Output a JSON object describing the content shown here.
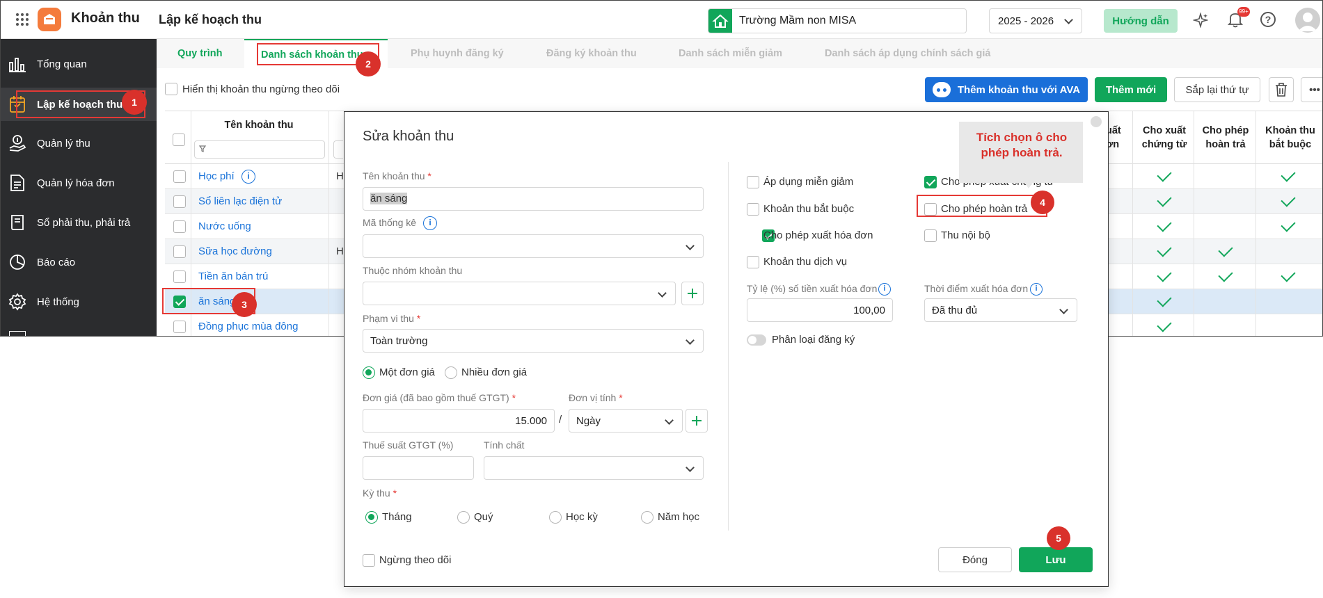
{
  "app": {
    "name": "Khoản thu",
    "page_title": "Lập kế hoạch thu",
    "school": "Trường Mầm non MISA",
    "year": "2025 - 2026",
    "guide_label": "Hướng dẫn",
    "notif_count": "99+"
  },
  "sidebar": {
    "items": [
      {
        "label": "Tổng quan"
      },
      {
        "label": "Lập kế hoạch thu"
      },
      {
        "label": "Quản lý thu"
      },
      {
        "label": "Quản lý hóa đơn"
      },
      {
        "label": "Sổ phải thu, phải trả"
      },
      {
        "label": "Báo cáo"
      },
      {
        "label": "Hệ thống"
      }
    ]
  },
  "tabs": [
    "Quy trình",
    "Danh sách khoản thu",
    "Phụ huynh đăng ký",
    "Đăng ký khoản thu",
    "Danh sách miễn giảm",
    "Danh sách áp dụng chính sách giá"
  ],
  "toolbar": {
    "show_inactive": "Hiển thị khoản thu ngừng theo dõi",
    "add_ava": "Thêm khoản thu với AVA",
    "add_new": "Thêm mới",
    "reorder": "Sắp lại thứ tự",
    "more": "•••"
  },
  "grid": {
    "col_name": "Tên khoản thu",
    "col_partial": "uất\nơn",
    "cols": [
      "Cho xuất chứng từ",
      "Cho phép hoàn trả",
      "Khoản thu bắt buộc"
    ],
    "rows": [
      {
        "name": "Học phí",
        "prefix": "H",
        "flags": [
          true,
          false,
          true
        ]
      },
      {
        "name": "Sổ liên lạc điện tử",
        "prefix": "",
        "flags": [
          true,
          false,
          true
        ]
      },
      {
        "name": "Nước uống",
        "prefix": "",
        "flags": [
          true,
          false,
          true
        ]
      },
      {
        "name": "Sữa học đường",
        "prefix": "H",
        "flags": [
          true,
          true,
          false
        ]
      },
      {
        "name": "Tiền ăn bán trú",
        "prefix": "",
        "flags": [
          true,
          true,
          true
        ]
      },
      {
        "name": "ăn sáng",
        "prefix": "",
        "flags": [
          true,
          false,
          false
        ]
      },
      {
        "name": "Đồng phục mùa đông",
        "prefix": "",
        "flags": [
          true,
          false,
          false
        ]
      }
    ]
  },
  "dialog": {
    "title": "Sửa khoản thu",
    "name_label": "Tên khoản thu",
    "name_value": "ăn sáng",
    "stat_label": "Mã thống kê",
    "group_label": "Thuộc nhóm khoản thu",
    "scope_label": "Phạm vi thu",
    "scope_value": "Toàn trường",
    "price_one": "Một đơn giá",
    "price_many": "Nhiều đơn giá",
    "price_label": "Đơn giá (đã bao gồm thuế GTGT)",
    "price_value": "15.000",
    "slash": "/",
    "unit_label": "Đơn vị tính",
    "unit_value": "Ngày",
    "vat_label": "Thuế suất GTGT (%)",
    "nature_label": "Tính chất",
    "period_label": "Kỳ thu",
    "periods": [
      "Tháng",
      "Quý",
      "Học kỳ",
      "Năm học"
    ],
    "stop_label": "Ngừng theo dõi",
    "checks": {
      "apply_discount": "Áp dụng miễn giảm",
      "allow_voucher": "Cho phép xuất chứng từ",
      "mandatory": "Khoản thu bắt buộc",
      "allow_refund": "Cho phép hoàn trả",
      "allow_invoice": "Cho phép xuất hóa đơn",
      "internal": "Thu nội bộ",
      "service": "Khoản thu dịch vụ"
    },
    "rate_label": "Tỷ lệ (%) số tiền xuất hóa đơn",
    "rate_value": "100,00",
    "time_label": "Thời điểm xuất hóa đơn",
    "time_value": "Đã thu đủ",
    "classify_label": "Phân loại đăng ký",
    "close_btn": "Đóng",
    "save_btn": "Lưu"
  },
  "callout": "Tích chọn ô cho phép hoàn trả.",
  "steps": [
    "1",
    "2",
    "3",
    "4",
    "5"
  ],
  "colors": {
    "accent": "#11a65a",
    "brand": "#f47b3c",
    "step": "#d9312b",
    "ava": "#1a6fd9"
  }
}
